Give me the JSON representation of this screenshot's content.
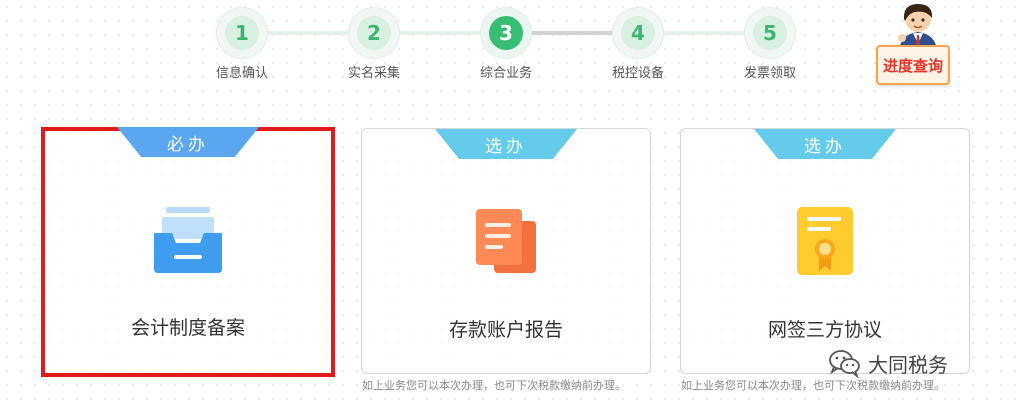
{
  "steps": [
    {
      "number": "1",
      "label": "信息确认",
      "active": false
    },
    {
      "number": "2",
      "label": "实名采集",
      "active": false
    },
    {
      "number": "3",
      "label": "综合业务",
      "active": true
    },
    {
      "number": "4",
      "label": "税控设备",
      "active": false
    },
    {
      "number": "5",
      "label": "发票领取",
      "active": false
    }
  ],
  "progress_query": {
    "label": "进度查询"
  },
  "cards": [
    {
      "tag": "必办",
      "title": "会计制度备案",
      "icon": "inbox-tray-icon",
      "note": ""
    },
    {
      "tag": "选办",
      "title": "存款账户报告",
      "icon": "documents-icon",
      "note": "如上业务您可以本次办理，也可下次税款缴纳前办理。"
    },
    {
      "tag": "选办",
      "title": "网签三方协议",
      "icon": "certificate-icon",
      "note": "如上业务您可以本次办理，也可下次税款缴纳前办理。"
    }
  ],
  "watermark": {
    "text": "大同税务",
    "icon": "wechat-icon"
  },
  "colors": {
    "step_active": "#37bd74",
    "step_inactive": "#d7f0e1",
    "step_number": "#40b36d",
    "tag_required": "#5aa7f0",
    "tag_optional": "#64cbea",
    "selection_border": "#e11a1a",
    "query_text": "#e4352a",
    "query_border": "#f2a552"
  }
}
